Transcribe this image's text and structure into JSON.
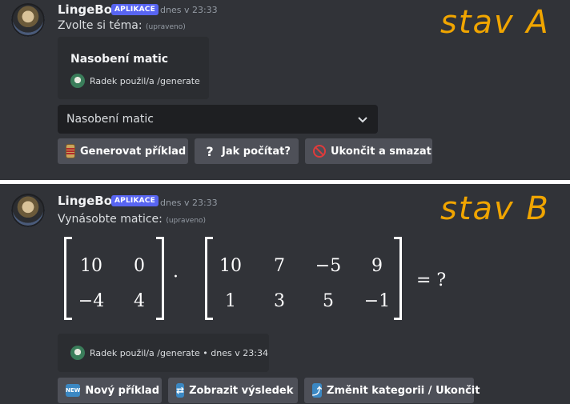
{
  "panelA": {
    "username": "LingeBot",
    "badge": "APLIKACE",
    "timestamp": "dnes v 23:33",
    "message": "Zvolte si téma:",
    "edited": "(upraveno)",
    "stav_label": "stav A",
    "embed": {
      "title": "Nasobení matic",
      "footer": "Radek použil/a /generate"
    },
    "select": {
      "value": "Nasobení matic"
    },
    "buttons": [
      {
        "icon": "abacus-icon",
        "label": "Generovat příklad"
      },
      {
        "icon": "question-icon",
        "label": "Jak počítat?"
      },
      {
        "icon": "prohibited-icon",
        "label": "Ukončit a smazat"
      }
    ]
  },
  "panelB": {
    "username": "LingeBot",
    "badge": "APLIKACE",
    "timestamp": "dnes v 23:33",
    "message": "Vynásobte matice:",
    "edited": "(upraveno)",
    "stav_label": "stav B",
    "matrixA": [
      [
        "10",
        "0"
      ],
      [
        "−4",
        "4"
      ]
    ],
    "dot": "·",
    "matrixB": [
      [
        "10",
        "7",
        "−5",
        "9"
      ],
      [
        "1",
        "3",
        "5",
        "−1"
      ]
    ],
    "equals": "= ?",
    "embed": {
      "footer": "Radek použil/a /generate • dnes v 23:34"
    },
    "buttons": [
      {
        "icon": "new-icon",
        "icon_text": "NEW",
        "label": "Nový příklad"
      },
      {
        "icon": "swap-icon",
        "label": "Zobrazit výsledek"
      },
      {
        "icon": "arrow-up-icon",
        "label": "Změnit kategorii / Ukončit"
      }
    ]
  }
}
